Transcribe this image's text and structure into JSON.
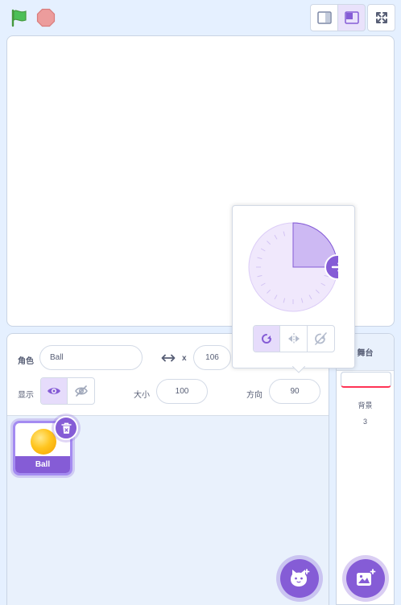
{
  "sprite_info": {
    "sprite_label": "角色",
    "sprite_name": "Ball",
    "x_label": "x",
    "x_value": "106",
    "show_label": "显示",
    "size_label": "大小",
    "size_value": "100",
    "direction_label": "方向",
    "direction_value": "90"
  },
  "sprites": [
    {
      "name": "Ball"
    }
  ],
  "stage_pane": {
    "title": "舞台",
    "backdrops_label": "背景",
    "backdrops_count": "3"
  },
  "direction_dial": {
    "direction_degrees": 90,
    "rotation_style": "all-around"
  },
  "colors": {
    "accent": "#855cd6",
    "background": "#e5f0ff",
    "text": "#575e75",
    "flag": "#4cbf56",
    "stop": "#ec9c9c"
  },
  "icons": {
    "flag": "green-flag-icon",
    "stop": "stop-icon",
    "small_stage": "small-stage-icon",
    "large_stage": "large-stage-icon",
    "fullscreen": "fullscreen-icon",
    "show": "eye-icon",
    "hide": "eye-slash-icon",
    "delete": "trash-icon",
    "choose_sprite": "cat-plus-icon",
    "choose_backdrop": "image-plus-icon"
  }
}
